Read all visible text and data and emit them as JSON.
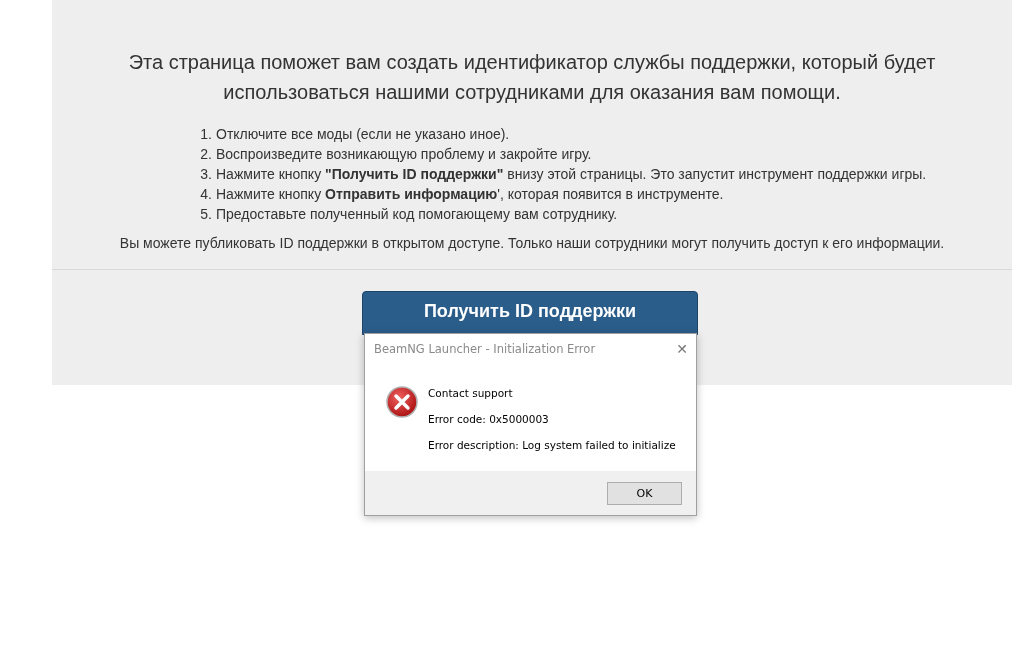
{
  "intro": "Эта страница поможет вам создать идентификатор службы поддержки, который будет использоваться нашими сотрудниками для оказания вам помощи.",
  "steps": [
    "Отключите все моды (если не указано иное).",
    "Воспроизведите возникающую проблему и закройте игру.",
    "Нажмите кнопку **\"Получить ID поддержки\"** внизу этой страницы. Это запустит инструмент поддержки игры.",
    "Нажмите кнопку **Отправить информацию**', которая появится в инструменте.",
    "Предоставьте полученный код помогающему вам сотруднику."
  ],
  "step_numbers": [
    "1.",
    "2.",
    "3.",
    "4.",
    "5."
  ],
  "note": "Вы можете публиковать ID поддержки в открытом доступе. Только наши сотрудники могут получить доступ к его информации.",
  "support_button": "Получить ID поддержки",
  "dialog": {
    "title": "BeamNG Launcher - Initialization Error",
    "close": "✕",
    "lines": [
      "Contact support",
      "Error code: 0x5000003",
      "Error description: Log system failed to initialize"
    ],
    "button": "OK"
  }
}
